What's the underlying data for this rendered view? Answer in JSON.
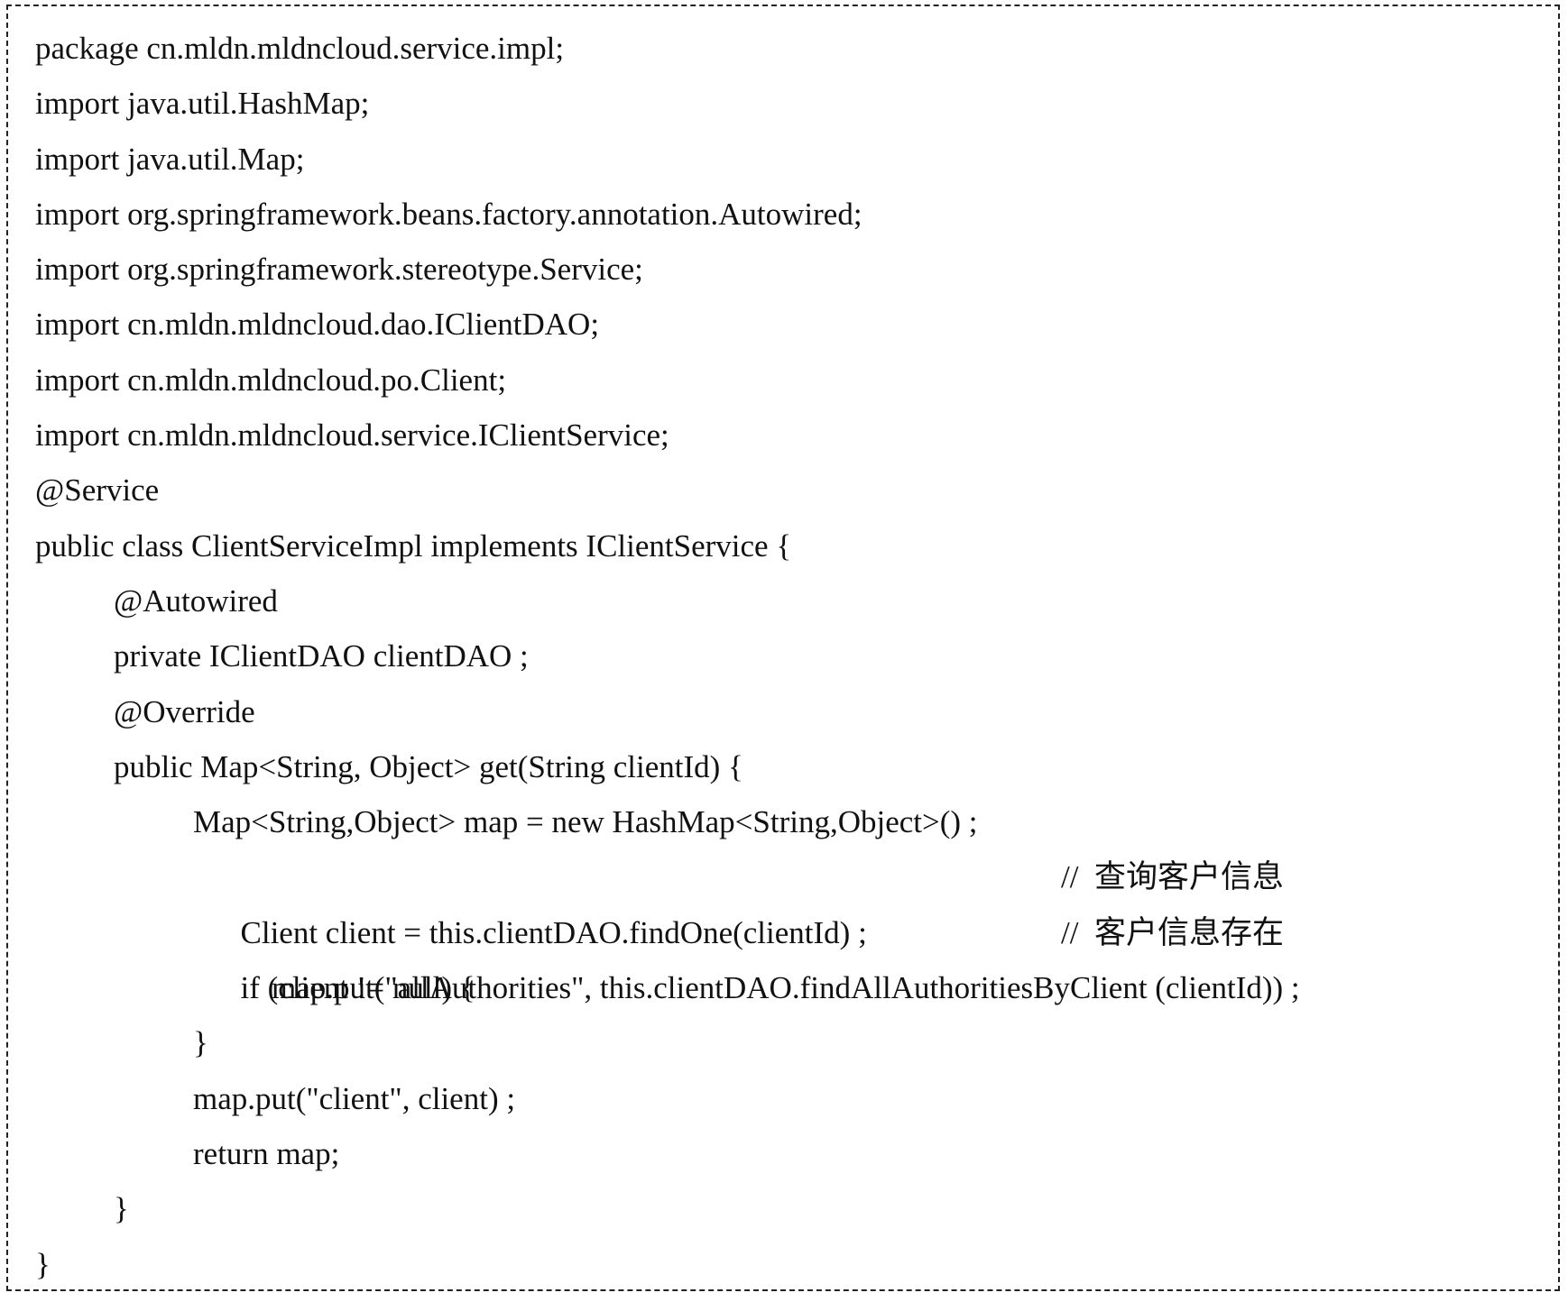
{
  "code": {
    "lines": [
      "package cn.mldn.mldncloud.service.impl;",
      "import java.util.HashMap;",
      "import java.util.Map;",
      "import org.springframework.beans.factory.annotation.Autowired;",
      "import org.springframework.stereotype.Service;",
      "import cn.mldn.mldncloud.dao.IClientDAO;",
      "import cn.mldn.mldncloud.po.Client;",
      "import cn.mldn.mldncloud.service.IClientService;",
      "@Service",
      "public class ClientServiceImpl implements IClientService {",
      "@Autowired",
      "private IClientDAO clientDAO ;",
      "@Override",
      "public Map<String, Object> get(String clientId) {",
      "Map<String,Object> map = new HashMap<String,Object>() ;",
      "Client client = this.clientDAO.findOne(clientId) ;",
      "if (client != null) {",
      "map.put(\"allAuthorities\", this.clientDAO.findAllAuthoritiesByClient (clientId)) ;",
      "}",
      "map.put(\"client\", client) ;",
      "return map;",
      "}",
      "}"
    ],
    "comments": {
      "find_client": "//  查询客户信息",
      "client_exists": "//  客户信息存在"
    }
  }
}
